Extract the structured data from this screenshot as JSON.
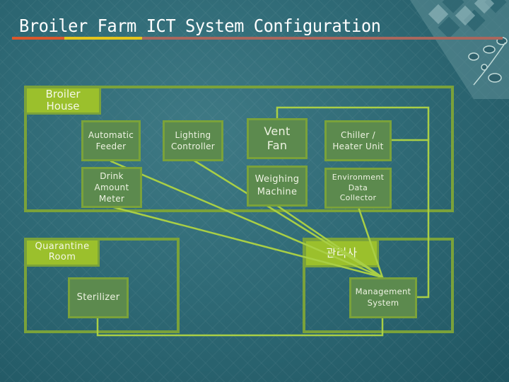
{
  "title": "Broiler Farm ICT System Configuration",
  "colors": {
    "background": "#2f6470",
    "region_border": "#7aa23a",
    "label_fill": "#9bc02c",
    "device_fill": "#5c8a4e",
    "wire": "#a9cf45",
    "underline": [
      "#d9582c",
      "#e4c41c",
      "#a8675d"
    ]
  },
  "regions": {
    "broiler_house": {
      "label": "Broiler\nHouse"
    },
    "quarantine_room": {
      "label": "Quarantine\nRoom"
    },
    "management_building": {
      "label": "관리사"
    }
  },
  "devices": {
    "automatic_feeder": "Automatic\nFeeder",
    "drink_amount_meter": "Drink\nAmount\nMeter",
    "lighting_controller": "Lighting\nController",
    "vent_fan": "Vent\nFan",
    "weighing_machine": "Weighing\nMachine",
    "chiller_heater_unit": "Chiller /\nHeater Unit",
    "environment_data_collector": "Environment\nData\nCollector",
    "sterilizer": "Sterilizer",
    "management_system": "Management\nSystem"
  },
  "connections": [
    [
      "automatic_feeder",
      "management_system"
    ],
    [
      "drink_amount_meter",
      "management_system"
    ],
    [
      "lighting_controller",
      "management_system"
    ],
    [
      "weighing_machine",
      "management_system"
    ],
    [
      "environment_data_collector",
      "management_system"
    ],
    [
      "vent_fan",
      "management_system"
    ],
    [
      "chiller_heater_unit",
      "management_system"
    ],
    [
      "sterilizer",
      "management_system"
    ]
  ]
}
